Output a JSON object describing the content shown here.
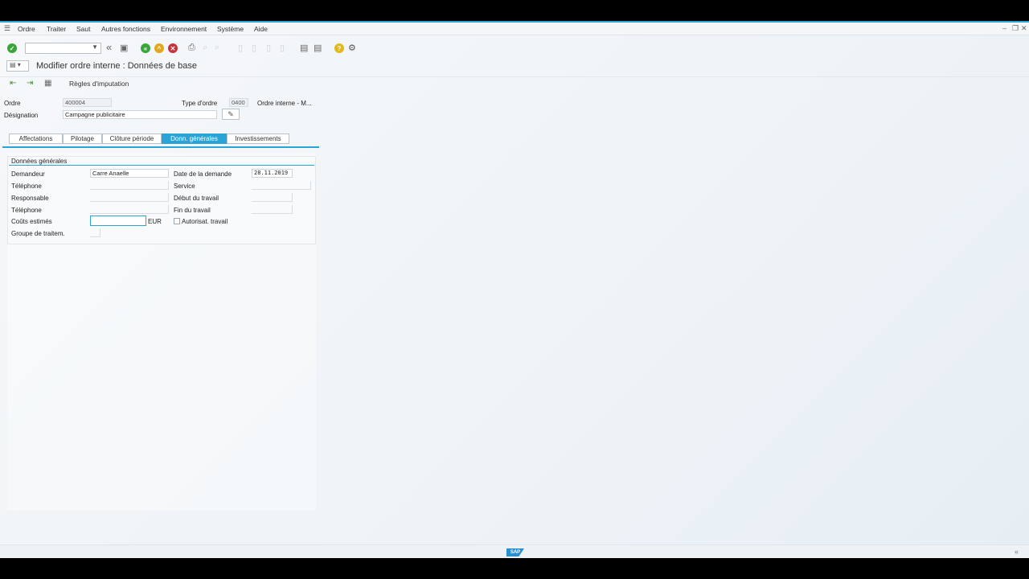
{
  "menubar": {
    "items": [
      "Ordre",
      "Traiter",
      "Saut",
      "Autres fonctions",
      "Environnement",
      "Système",
      "Aide"
    ]
  },
  "toolbar": {
    "command_field_value": "",
    "icons": [
      "enter-icon",
      "save-icon",
      "back-icon",
      "exit-icon",
      "cancel-icon",
      "print-icon",
      "find-icon",
      "find-next-icon",
      "first-page-icon",
      "prev-page-icon",
      "next-page-icon",
      "last-page-icon",
      "create-session-icon",
      "shortcut-icon",
      "help-icon",
      "customize-icon"
    ]
  },
  "title": {
    "text": "Modifier ordre interne : Données de base"
  },
  "app_toolbar": {
    "regles_label": "Règles d'imputation"
  },
  "header": {
    "ordre_label": "Ordre",
    "ordre_value": "400004",
    "type_label": "Type d'ordre",
    "type_value": "0400",
    "type_desc": "Ordre interne - M...",
    "designation_label": "Désignation",
    "designation_value": "Campagne publicitaire"
  },
  "tabs": [
    {
      "label": "Affectations",
      "active": false
    },
    {
      "label": "Pilotage",
      "active": false
    },
    {
      "label": "Clôture période",
      "active": false
    },
    {
      "label": "Donn. générales",
      "active": true
    },
    {
      "label": "Investissements",
      "active": false
    }
  ],
  "group": {
    "title": "Données générales",
    "demandeur_label": "Demandeur",
    "demandeur_value": "Carre Anaelle",
    "telephone1_label": "Téléphone",
    "telephone1_value": "",
    "responsable_label": "Responsable",
    "responsable_value": "",
    "telephone2_label": "Téléphone",
    "telephone2_value": "",
    "couts_label": "Coûts estimés",
    "couts_value": "",
    "currency": "EUR",
    "groupe_label": "Groupe de traitem.",
    "groupe_value": "",
    "date_demande_label": "Date de la demande",
    "date_demande_value": "28.11.2019",
    "service_label": "Service",
    "service_value": "",
    "debut_label": "Début du travail",
    "debut_value": "",
    "fin_label": "Fin du travail",
    "fin_value": "",
    "autorisat_label": "Autorisat. travail",
    "autorisat_checked": false
  },
  "colors": {
    "accent": "#2aa3d6",
    "enter_green": "#3aa53a",
    "back_green": "#3aa53a",
    "exit_yellow": "#e2a81c",
    "cancel_red": "#c8323a"
  }
}
